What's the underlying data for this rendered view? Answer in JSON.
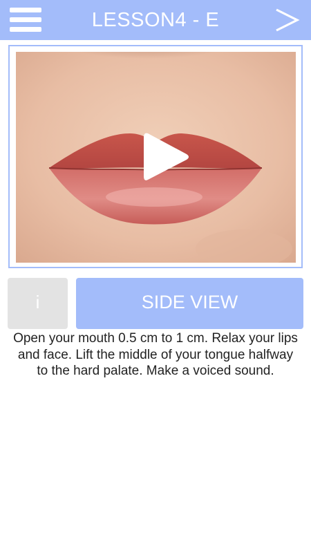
{
  "header": {
    "menu_icon": "hamburger-menu-icon",
    "title": "LESSON4 - E",
    "next_icon": "chevron-right-icon",
    "background_color": "#a3bcfa"
  },
  "video": {
    "play_icon": "play-icon"
  },
  "buttons": {
    "info_label": "i",
    "side_view_label": "SIDE VIEW",
    "info_color": "#e3e3e3",
    "side_view_color": "#a3bcfa"
  },
  "description": "Open your mouth 0.5 cm to 1 cm. Relax your lips and face. Lift the middle of your tongue halfway to the hard palate. Make a voiced sound."
}
